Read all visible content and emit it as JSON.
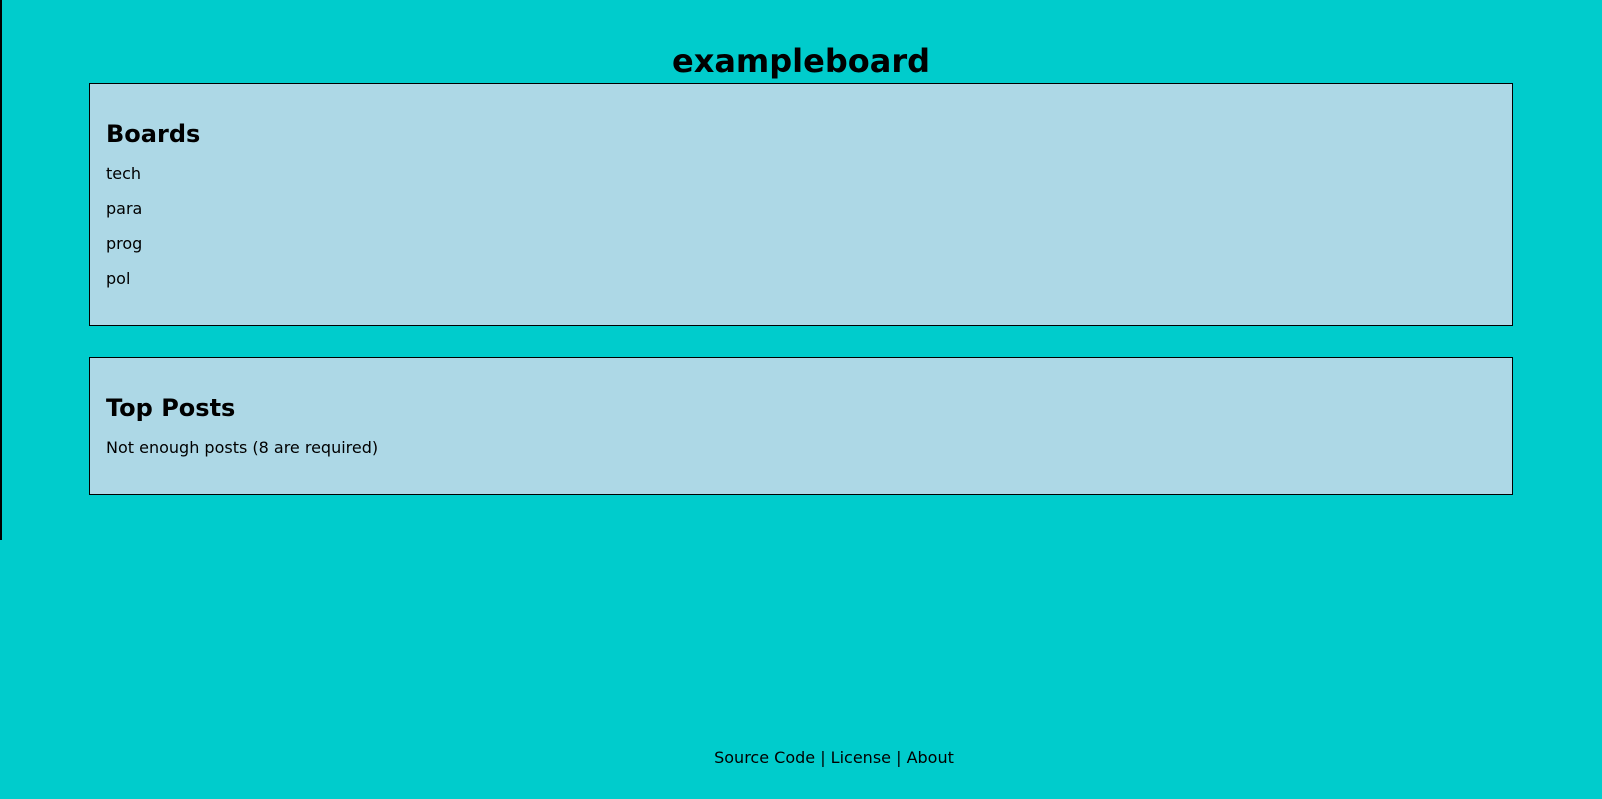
{
  "site": {
    "title": "exampleboard"
  },
  "boards": {
    "heading": "Boards",
    "items": [
      {
        "label": "tech"
      },
      {
        "label": "para"
      },
      {
        "label": "prog"
      },
      {
        "label": "pol"
      }
    ]
  },
  "top_posts": {
    "heading": "Top Posts",
    "message": "Not enough posts (8 are required)"
  },
  "footer": {
    "links": [
      {
        "label": "Source Code"
      },
      {
        "label": "License"
      },
      {
        "label": "About"
      }
    ],
    "separator": " | "
  },
  "colors": {
    "background": "#00cccc",
    "panel": "#add8e6",
    "text": "#000000"
  }
}
